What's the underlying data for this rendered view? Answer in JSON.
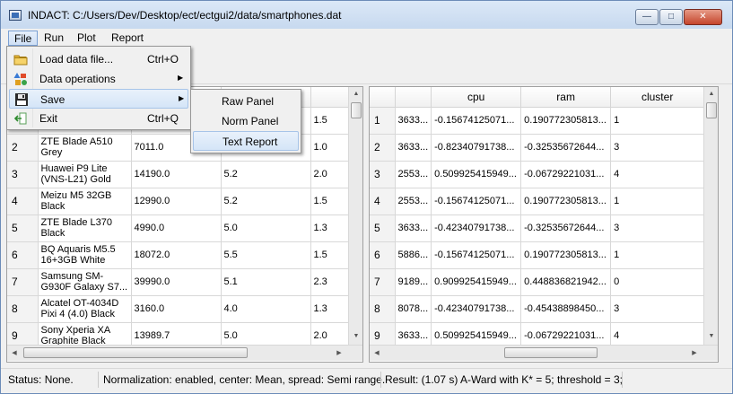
{
  "window": {
    "title": "INDACT: C:/Users/Dev/Desktop/ect/ectgui2/data/smartphones.dat",
    "min_glyph": "—",
    "max_glyph": "□",
    "close_glyph": "✕"
  },
  "menubar": {
    "items": [
      "File",
      "Run",
      "Plot",
      "Report"
    ]
  },
  "file_menu": {
    "items": [
      {
        "label": "Load data file...",
        "shortcut": "Ctrl+O",
        "icon": "folder-icon"
      },
      {
        "label": "Data operations",
        "shortcut": "",
        "icon": "shapes-icon",
        "submenu_arrow": "▶"
      },
      {
        "label": "Save",
        "shortcut": "",
        "icon": "floppy-disk-icon",
        "submenu_arrow": "▶"
      },
      {
        "label": "Exit",
        "shortcut": "Ctrl+Q",
        "icon": "exit-icon"
      }
    ]
  },
  "save_menu": {
    "items": [
      "Raw Panel",
      "Norm Panel",
      "Text Report"
    ]
  },
  "left_table": {
    "rows": [
      {
        "num": "1",
        "name": "",
        "price": "",
        "screen": "",
        "cam": "1.5"
      },
      {
        "num": "2",
        "name": "ZTE Blade A510 Grey",
        "price": "7011.0",
        "screen": "",
        "cam": "1.0"
      },
      {
        "num": "3",
        "name": "Huawei P9 Lite (VNS-L21)  Gold",
        "price": "14190.0",
        "screen": "5.2",
        "cam": "2.0"
      },
      {
        "num": "4",
        "name": "Meizu M5 32GB Black",
        "price": "12990.0",
        "screen": "5.2",
        "cam": "1.5"
      },
      {
        "num": "5",
        "name": "ZTE Blade L370 Black",
        "price": "4990.0",
        "screen": "5.0",
        "cam": "1.3"
      },
      {
        "num": "6",
        "name": "BQ Aquaris M5.5 16+3GB  White",
        "price": "18072.0",
        "screen": "5.5",
        "cam": "1.5"
      },
      {
        "num": "7",
        "name": "Samsung SM-G930F Galaxy S7...",
        "price": "39990.0",
        "screen": "5.1",
        "cam": "2.3"
      },
      {
        "num": "8",
        "name": "Alcatel OT-4034D Pixi 4 (4.0)  Black",
        "price": "3160.0",
        "screen": "4.0",
        "cam": "1.3"
      },
      {
        "num": "9",
        "name": "Sony Xperia XA Graphite Black",
        "price": "13989.7",
        "screen": "5.0",
        "cam": "2.0"
      }
    ]
  },
  "right_table": {
    "headers": [
      "",
      "cpu",
      "ram",
      "cluster"
    ],
    "rows": [
      {
        "num": "1",
        "col0": "3633...",
        "cpu": "-0.15674125071...",
        "ram": "0.190772305813...",
        "cluster": "1"
      },
      {
        "num": "2",
        "col0": "3633...",
        "cpu": "-0.82340791738...",
        "ram": "-0.32535672644...",
        "cluster": "3"
      },
      {
        "num": "3",
        "col0": "2553...",
        "cpu": "0.509925415949...",
        "ram": "-0.06729221031...",
        "cluster": "4"
      },
      {
        "num": "4",
        "col0": "2553...",
        "cpu": "-0.15674125071...",
        "ram": "0.190772305813...",
        "cluster": "1"
      },
      {
        "num": "5",
        "col0": "3633...",
        "cpu": "-0.42340791738...",
        "ram": "-0.32535672644...",
        "cluster": "3"
      },
      {
        "num": "6",
        "col0": "5886...",
        "cpu": "-0.15674125071...",
        "ram": "0.190772305813...",
        "cluster": "1"
      },
      {
        "num": "7",
        "col0": "9189...",
        "cpu": "0.909925415949...",
        "ram": "0.448836821942...",
        "cluster": "0"
      },
      {
        "num": "8",
        "col0": "8078...",
        "cpu": "-0.42340791738...",
        "ram": "-0.45438898450...",
        "cluster": "3"
      },
      {
        "num": "9",
        "col0": "3633...",
        "cpu": "0.509925415949...",
        "ram": "-0.06729221031...",
        "cluster": "4"
      }
    ]
  },
  "scroll_glyphs": {
    "up": "▲",
    "down": "▼",
    "left": "◀",
    "right": "▶"
  },
  "status": {
    "left": "Status: None.",
    "middle": "Normalization: enabled, center: Mean, spread: Semi range.",
    "right": "Result: (1.07 s) A-Ward with K* = 5; threshold = 3;"
  }
}
